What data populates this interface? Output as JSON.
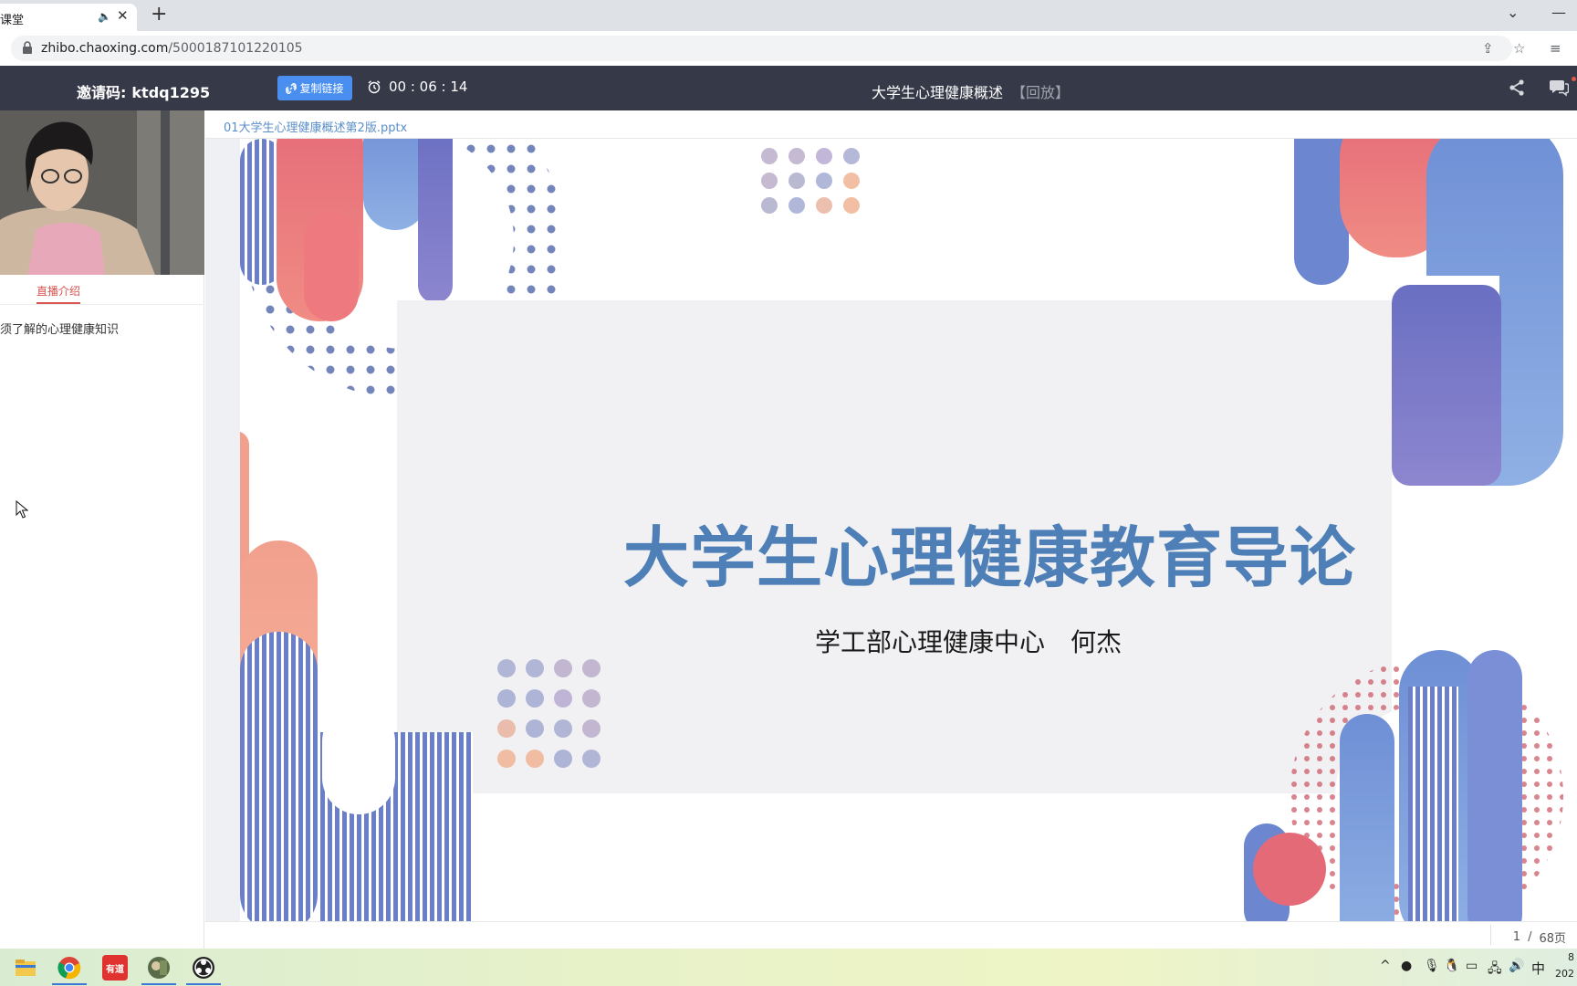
{
  "browser": {
    "tab_title": "课堂",
    "new_tab": "+",
    "url_host": "zhibo.chaoxing.com",
    "url_path": "/5000187101220105"
  },
  "header": {
    "invite_label": "邀请码:",
    "invite_code": "ktdq1295",
    "copy_link": "复制链接",
    "timer": "00 : 06 : 14",
    "course_title": "大学生心理健康概述",
    "replay": "【回放】"
  },
  "sidebar": {
    "tab_intro": "直播介绍",
    "intro_text": "须了解的心理健康知识"
  },
  "main": {
    "filename": "01大学生心理健康概述第2版.pptx",
    "slide_title": "大学生心理健康教育导论",
    "slide_subtitle": "学工部心理健康中心　何杰",
    "page_current": "1",
    "page_sep": "/",
    "page_total": "68页"
  },
  "taskbar": {
    "youdao_label": "有道",
    "ime": "中",
    "clock_time": "8",
    "clock_year": "202"
  },
  "colors": {
    "header_bg": "#363a48",
    "accent_blue": "#4a8ff0",
    "slide_title": "#4e7fb7",
    "active_tab": "#d9534f"
  }
}
